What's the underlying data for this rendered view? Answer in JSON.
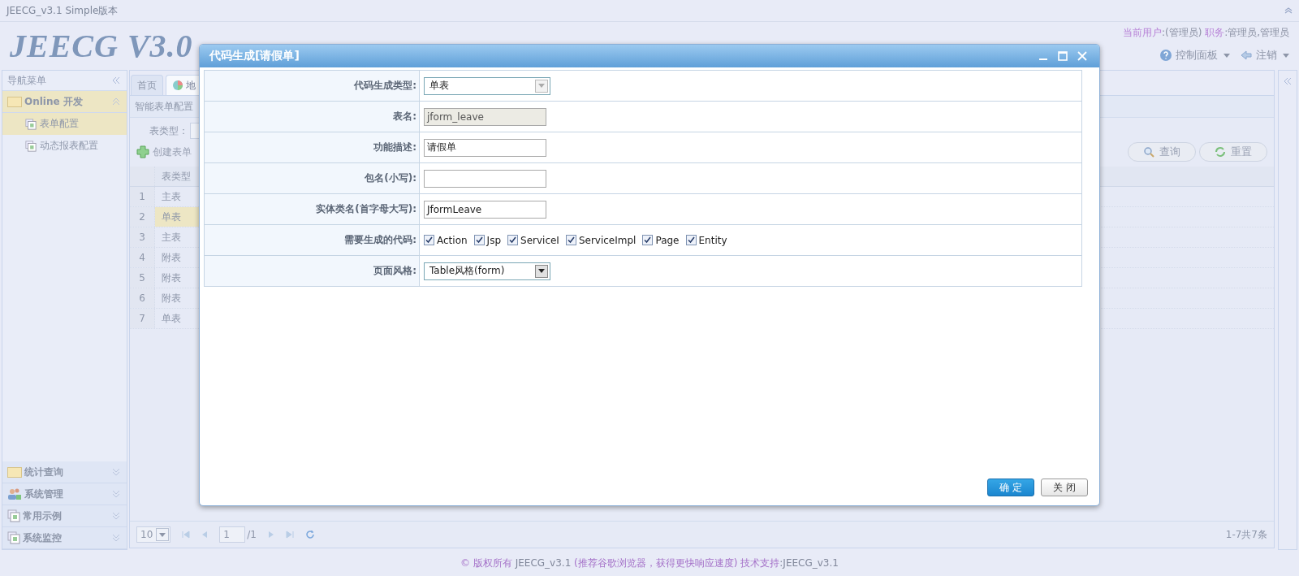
{
  "window": {
    "title": "JEECG_v3.1 Simple版本"
  },
  "header": {
    "logo": "JEECG V3.0",
    "user_info": [
      {
        "kind": "label",
        "text": "当前用户"
      },
      {
        "kind": "value",
        "text": ":(管理员) "
      },
      {
        "kind": "label",
        "text": "职务"
      },
      {
        "kind": "value",
        "text": ":管理员,管理员"
      }
    ],
    "menus": [
      {
        "label": "控制面板"
      },
      {
        "label": "注销"
      }
    ]
  },
  "sidebar": {
    "title": "导航菜单",
    "groups": [
      {
        "label": "Online 开发",
        "expanded": true,
        "children": [
          {
            "label": "表单配置",
            "selected": true
          },
          {
            "label": "动态报表配置",
            "selected": false
          }
        ]
      },
      {
        "label": "统计查询",
        "expanded": false
      },
      {
        "label": "系统管理",
        "expanded": false
      },
      {
        "label": "常用示例",
        "expanded": false
      },
      {
        "label": "系统监控",
        "expanded": false
      }
    ]
  },
  "tabs": [
    {
      "label": "首页",
      "selected": false
    },
    {
      "label": "地",
      "selected": true
    }
  ],
  "panel": {
    "title": "智能表单配置",
    "search_label": "表类型：",
    "create_button": "创建表单",
    "query_button": "查询",
    "reset_button": "重置",
    "table": {
      "columns": [
        "表类型"
      ],
      "rows": [
        {
          "number": "1",
          "type": "主表",
          "selected": false
        },
        {
          "number": "2",
          "type": "单表",
          "selected": true
        },
        {
          "number": "3",
          "type": "主表",
          "selected": false
        },
        {
          "number": "4",
          "type": "附表",
          "selected": false
        },
        {
          "number": "5",
          "type": "附表",
          "selected": false
        },
        {
          "number": "6",
          "type": "附表",
          "selected": false
        },
        {
          "number": "7",
          "type": "单表",
          "selected": false
        }
      ]
    },
    "pager": {
      "page_size": "10",
      "page": "1",
      "page_count": "/1",
      "summary": "1-7共7条"
    }
  },
  "dialog": {
    "title": "代码生成[请假单]",
    "fields": [
      {
        "label": "代码生成类型:",
        "kind": "select",
        "value": "单表",
        "disabled": true
      },
      {
        "label": "表名:",
        "kind": "readonly",
        "value": "jform_leave"
      },
      {
        "label": "功能描述:",
        "kind": "input",
        "value": "请假单"
      },
      {
        "label": "包名(小写):",
        "kind": "input"
      },
      {
        "label": "实体类名(首字母大写):",
        "kind": "input",
        "value": "JformLeave"
      },
      {
        "label": "需要生成的代码:",
        "kind": "checkboxes",
        "options": [
          {
            "label": "Action",
            "checked": true
          },
          {
            "label": "Jsp",
            "checked": true
          },
          {
            "label": "ServiceI",
            "checked": true
          },
          {
            "label": "ServiceImpl",
            "checked": true
          },
          {
            "label": "Page",
            "checked": true
          },
          {
            "label": "Entity",
            "checked": true
          }
        ]
      },
      {
        "label": "页面风格:",
        "kind": "select",
        "value": "Table风格(form)",
        "disabled": false
      }
    ],
    "buttons": [
      {
        "label": "确 定",
        "kind": "primary"
      },
      {
        "label": "关 闭",
        "kind": "default"
      }
    ]
  },
  "footer": [
    {
      "kind": "label",
      "text": "© 版权所有 "
    },
    {
      "kind": "value",
      "text": "JEECG_v3.1"
    },
    {
      "kind": "label",
      "text": " (推荐谷歌浏览器，获得更快响应速度) 技术支持"
    },
    {
      "kind": "value",
      "text": ":JEECG_v3.1"
    }
  ]
}
